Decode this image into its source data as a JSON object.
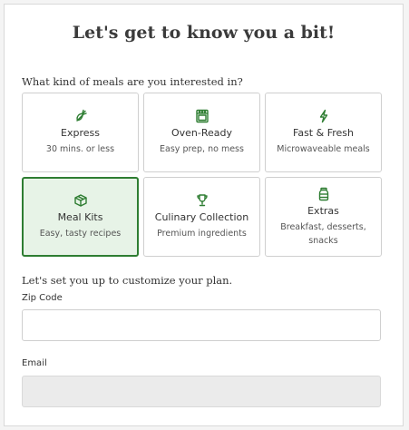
{
  "title": "Let's get to know you a bit!",
  "question": "What kind of meals are you interested in?",
  "accent_color": "#2e7d32",
  "tiles": [
    {
      "name": "Express",
      "desc": "30 mins. or less",
      "icon": "carrot-icon",
      "selected": false
    },
    {
      "name": "Oven-Ready",
      "desc": "Easy prep, no mess",
      "icon": "oven-icon",
      "selected": false
    },
    {
      "name": "Fast & Fresh",
      "desc": "Microwaveable meals",
      "icon": "lightning-icon",
      "selected": false
    },
    {
      "name": "Meal Kits",
      "desc": "Easy, tasty recipes",
      "icon": "box-icon",
      "selected": true
    },
    {
      "name": "Culinary Collection",
      "desc": "Premium ingredients",
      "icon": "trophy-icon",
      "selected": false
    },
    {
      "name": "Extras",
      "desc": "Breakfast, desserts, snacks",
      "icon": "jar-icon",
      "selected": false
    }
  ],
  "plan_heading": "Let's set you up to customize your plan.",
  "zip": {
    "label": "Zip Code",
    "value": ""
  },
  "email": {
    "label": "Email",
    "value": ""
  }
}
